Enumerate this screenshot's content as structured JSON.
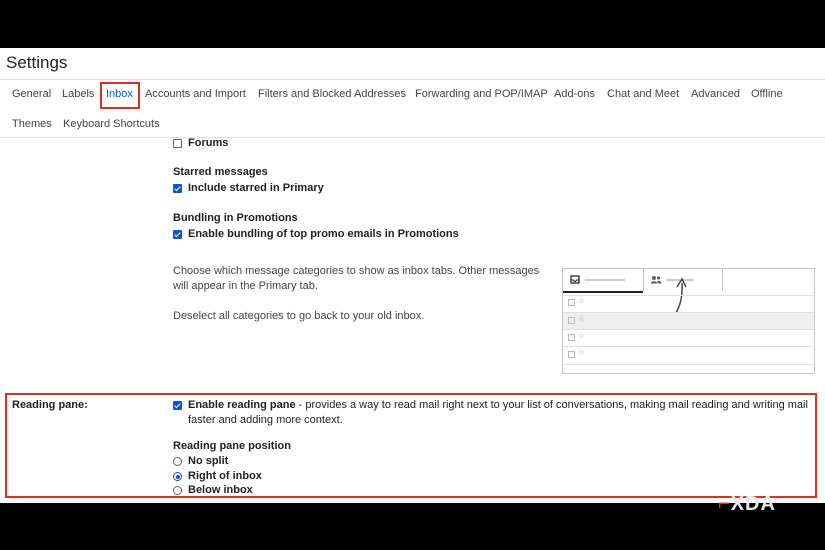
{
  "page": {
    "title": "Settings"
  },
  "tabs": [
    {
      "label": "General"
    },
    {
      "label": "Labels"
    },
    {
      "label": "Inbox",
      "active": true
    },
    {
      "label": "Accounts and Import"
    },
    {
      "label": "Filters and Blocked Addresses"
    },
    {
      "label": "Forwarding and POP/IMAP"
    },
    {
      "label": "Add-ons"
    },
    {
      "label": "Chat and Meet"
    },
    {
      "label": "Advanced"
    },
    {
      "label": "Offline"
    },
    {
      "label": "Themes"
    },
    {
      "label": "Keyboard Shortcuts"
    }
  ],
  "categories": {
    "forums_label": "Forums",
    "forums_checked": false,
    "starred_heading": "Starred messages",
    "starred_option": "Include starred in Primary",
    "starred_checked": true,
    "bundling_heading": "Bundling in Promotions",
    "bundling_option": "Enable bundling of top promo emails in Promotions",
    "bundling_checked": true,
    "description_1": "Choose which message categories to show as inbox tabs. Other messages will appear in the Primary tab.",
    "description_2": "Deselect all categories to go back to your old inbox."
  },
  "reading_pane": {
    "section_label": "Reading pane:",
    "enable_label": "Enable reading pane",
    "enable_desc": " - provides a way to read mail right next to your list of conversations, making mail reading and writing mail faster and adding more context.",
    "enable_checked": true,
    "position_heading": "Reading pane position",
    "options": [
      {
        "label": "No split",
        "selected": false
      },
      {
        "label": "Right of inbox",
        "selected": true
      },
      {
        "label": "Below inbox",
        "selected": false
      }
    ]
  },
  "watermark": {
    "text": "XDA"
  },
  "colors": {
    "accent": "#0b57d0",
    "highlight": "#d93025"
  },
  "icons": [
    "inbox-tray-icon",
    "people-icon",
    "arrow-icon",
    "star-icon"
  ]
}
